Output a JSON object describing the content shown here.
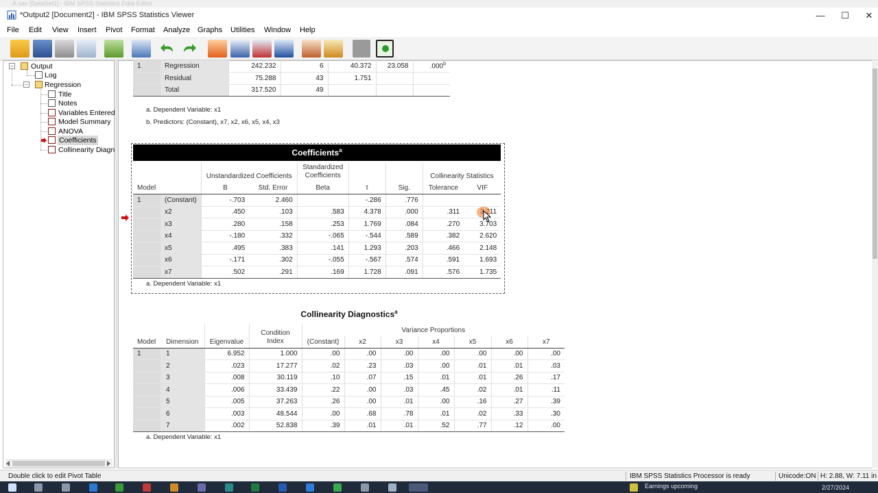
{
  "background_title": "A.sav [DataSet1] - IBM SPSS Statistics Data Editor",
  "window": {
    "title": "*Output2 [Document2] - IBM SPSS Statistics Viewer",
    "minimize": "—",
    "maximize": "☐",
    "close": "✕"
  },
  "menu": [
    "File",
    "Edit",
    "View",
    "Insert",
    "Pivot",
    "Format",
    "Analyze",
    "Graphs",
    "Utilities",
    "Window",
    "Help"
  ],
  "tree": {
    "output": "Output",
    "log": "Log",
    "regression": "Regression",
    "title": "Title",
    "notes": "Notes",
    "variables_entered": "Variables Entered",
    "model_summary": "Model Summary",
    "anova": "ANOVA",
    "coefficients": "Coefficients",
    "collinearity": "Collinearity Diagn",
    "expand_minus": "−"
  },
  "anova": {
    "rows": [
      {
        "model": "1",
        "label": "Regression",
        "ss": "242.232",
        "df": "6",
        "ms": "40.372",
        "f": "23.058",
        "sig": ".000",
        "sig_sup": "b"
      },
      {
        "model": "",
        "label": "Residual",
        "ss": "75.288",
        "df": "43",
        "ms": "1.751",
        "f": "",
        "sig": "",
        "sig_sup": ""
      },
      {
        "model": "",
        "label": "Total",
        "ss": "317.520",
        "df": "49",
        "ms": "",
        "f": "",
        "sig": "",
        "sig_sup": ""
      }
    ],
    "foot1": "a. Dependent Variable: x1",
    "foot2": "b. Predictors: (Constant), x7, x2, x6, x5, x4, x3"
  },
  "coef": {
    "title": "Coefficients",
    "title_sup": "a",
    "h_model": "Model",
    "h_unstd": "Unstandardized Coefficients",
    "h_std": "Standardized Coefficients",
    "h_colstats": "Collinearity Statistics",
    "h_b": "B",
    "h_se": "Std. Error",
    "h_beta": "Beta",
    "h_t": "t",
    "h_sig": "Sig.",
    "h_tol": "Tolerance",
    "h_vif": "VIF",
    "rows": [
      {
        "model": "1",
        "label": "(Constant)",
        "b": "-.703",
        "se": "2.460",
        "beta": "",
        "t": "-.286",
        "sig": ".776",
        "tol": "",
        "vif": ""
      },
      {
        "model": "",
        "label": "x2",
        "b": ".450",
        "se": ".103",
        "beta": ".583",
        "t": "4.378",
        "sig": ".000",
        "tol": ".311",
        "vif": "3.211"
      },
      {
        "model": "",
        "label": "x3",
        "b": ".280",
        "se": ".158",
        "beta": ".253",
        "t": "1.769",
        "sig": ".084",
        "tol": ".270",
        "vif": "3.703"
      },
      {
        "model": "",
        "label": "x4",
        "b": "-.180",
        "se": ".332",
        "beta": "-.065",
        "t": "-.544",
        "sig": ".589",
        "tol": ".382",
        "vif": "2.620"
      },
      {
        "model": "",
        "label": "x5",
        "b": ".495",
        "se": ".383",
        "beta": ".141",
        "t": "1.293",
        "sig": ".203",
        "tol": ".466",
        "vif": "2.148"
      },
      {
        "model": "",
        "label": "x6",
        "b": "-.171",
        "se": ".302",
        "beta": "-.055",
        "t": "-.567",
        "sig": ".574",
        "tol": ".591",
        "vif": "1.693"
      },
      {
        "model": "",
        "label": "x7",
        "b": ".502",
        "se": ".291",
        "beta": ".169",
        "t": "1.728",
        "sig": ".091",
        "tol": ".576",
        "vif": "1.735"
      }
    ],
    "foot": "a. Dependent Variable: x1"
  },
  "colldiag": {
    "title": "Collinearity Diagnostics",
    "title_sup": "a",
    "h_model": "Model",
    "h_dim": "Dimension",
    "h_eigen": "Eigenvalue",
    "h_cond": "Condition Index",
    "h_varprop": "Variance Proportions",
    "h_cols": [
      "(Constant)",
      "x2",
      "x3",
      "x4",
      "x5",
      "x6",
      "x7"
    ],
    "rows": [
      {
        "model": "1",
        "dim": "1",
        "eigen": "6.952",
        "cond": "1.000",
        "v": [
          ".00",
          ".00",
          ".00",
          ".00",
          ".00",
          ".00",
          ".00"
        ]
      },
      {
        "model": "",
        "dim": "2",
        "eigen": ".023",
        "cond": "17.277",
        "v": [
          ".02",
          ".23",
          ".03",
          ".00",
          ".01",
          ".01",
          ".03"
        ]
      },
      {
        "model": "",
        "dim": "3",
        "eigen": ".008",
        "cond": "30.119",
        "v": [
          ".10",
          ".07",
          ".15",
          ".01",
          ".01",
          ".26",
          ".17"
        ]
      },
      {
        "model": "",
        "dim": "4",
        "eigen": ".006",
        "cond": "33.439",
        "v": [
          ".22",
          ".00",
          ".03",
          ".45",
          ".02",
          ".01",
          ".11"
        ]
      },
      {
        "model": "",
        "dim": "5",
        "eigen": ".005",
        "cond": "37.263",
        "v": [
          ".26",
          ".00",
          ".01",
          ".00",
          ".16",
          ".27",
          ".39"
        ]
      },
      {
        "model": "",
        "dim": "6",
        "eigen": ".003",
        "cond": "48.544",
        "v": [
          ".00",
          ".68",
          ".78",
          ".01",
          ".02",
          ".33",
          ".30"
        ]
      },
      {
        "model": "",
        "dim": "7",
        "eigen": ".002",
        "cond": "52.838",
        "v": [
          ".39",
          ".01",
          ".01",
          ".52",
          ".77",
          ".12",
          ".00"
        ]
      }
    ],
    "foot": "a. Dependent Variable: x1"
  },
  "status": {
    "hint": "Double click to edit Pivot Table",
    "processor": "IBM SPSS Statistics Processor is ready",
    "unicode": "Unicode:ON",
    "dims": "H: 2.88, W: 7.11 in"
  },
  "taskbar": {
    "earnings": "Earnings upcoming",
    "date": "2/27/2024"
  },
  "colors": {
    "accent_red": "#d01010",
    "toolbar_bg": "#f3f3f3",
    "title_band": "#000000"
  }
}
